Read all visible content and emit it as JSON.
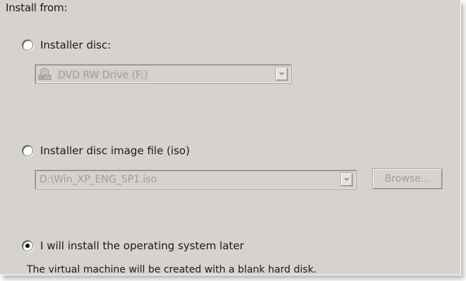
{
  "section_title": "Install from:",
  "options": {
    "disc": {
      "label": "Installer disc:",
      "selected": false
    },
    "iso": {
      "label": "Installer disc image file (iso)",
      "selected": false
    },
    "later": {
      "label": "I will install the operating system later",
      "selected": true
    }
  },
  "disc_drive": {
    "value": "DVD RW Drive (F:)",
    "icon": "dvd-drive-icon"
  },
  "iso_path": {
    "value": "D:\\Win_XP_ENG_SP1.iso"
  },
  "browse_button": {
    "label": "Browse..."
  },
  "later_note": "The virtual machine will be created with a blank hard disk.",
  "colors": {
    "panel": "#d6d3ce",
    "disabled_text": "#a09d98"
  }
}
